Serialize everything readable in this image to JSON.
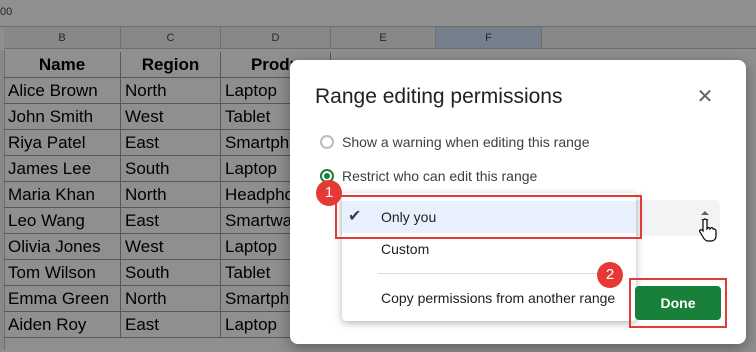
{
  "toolbar": {
    "cell_ref": "00"
  },
  "columns": [
    {
      "letter": "B"
    },
    {
      "letter": "C"
    },
    {
      "letter": "D"
    },
    {
      "letter": "E"
    },
    {
      "letter": "F"
    }
  ],
  "table": {
    "headers": [
      "Name",
      "Region",
      "Produ"
    ],
    "rows": [
      [
        "Alice Brown",
        "North",
        "Laptop"
      ],
      [
        "John Smith",
        "West",
        "Tablet"
      ],
      [
        "Riya Patel",
        "East",
        "Smartph"
      ],
      [
        "James Lee",
        "South",
        "Laptop"
      ],
      [
        "Maria Khan",
        "North",
        "Headpho"
      ],
      [
        "Leo Wang",
        "East",
        "Smartwa"
      ],
      [
        "Olivia Jones",
        "West",
        "Laptop"
      ],
      [
        "Tom Wilson",
        "South",
        "Tablet"
      ],
      [
        "Emma Green",
        "North",
        "Smartph"
      ],
      [
        "Aiden Roy",
        "East",
        "Laptop"
      ]
    ]
  },
  "dialog": {
    "title": "Range editing permissions",
    "close_icon": "close-icon",
    "option_warning": "Show a warning when editing this range",
    "option_restrict": "Restrict who can edit this range",
    "menu": {
      "item_only_you": "Only you",
      "item_custom": "Custom",
      "item_copy": "Copy permissions from another range"
    },
    "done_label": "Done"
  },
  "annotations": {
    "step1": "1",
    "step2": "2",
    "color": "#e53935"
  },
  "colors": {
    "accent": "#188038",
    "overlay": "rgba(0,0,0,0.44)"
  }
}
